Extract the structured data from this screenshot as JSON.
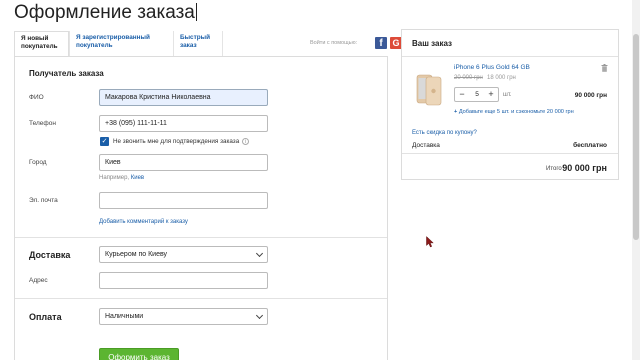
{
  "page": {
    "title": "Оформление заказа"
  },
  "tabs": [
    {
      "label_line1": "Я новый",
      "label_line2": "покупатель",
      "active": true
    },
    {
      "label_line1": "Я зарегистрированный",
      "label_line2": "покупатель",
      "active": false
    },
    {
      "label_line1": "Быстрый",
      "label_line2": "заказ",
      "active": false
    }
  ],
  "social": {
    "label": "Войти с помощью:",
    "facebook_glyph": "f",
    "google_glyph": "G"
  },
  "recipient": {
    "title": "Получатель заказа",
    "name_label": "ФИО",
    "name_value": "Макарова Кристина Николаевна",
    "phone_label": "Телефон",
    "phone_value": "+38 (095) 111-11-11",
    "no_call_label": "Не звонить мне для подтверждения заказа",
    "city_label": "Город",
    "city_value": "Киев",
    "city_hint_prefix": "Например,",
    "city_hint_link": "Киев",
    "email_label": "Эл. почта",
    "email_value": "",
    "add_comment_link": "Добавить комментарий к заказу"
  },
  "delivery": {
    "title": "Доставка",
    "method_value": "Курьером по Киеву",
    "address_label": "Адрес",
    "address_value": ""
  },
  "payment": {
    "title": "Оплата",
    "method_value": "Наличными"
  },
  "submit": {
    "label": "Оформить заказ"
  },
  "order": {
    "title": "Ваш заказ",
    "product_name": "iPhone 6 Plus Gold 64 GB",
    "old_price": "20 000 грн",
    "unit_price": "18 000 грн",
    "quantity": "5",
    "quantity_unit": "шт.",
    "line_total": "90 000 грн",
    "upsell": "Добавьте еще 5 шт. и сэкономьте 20 000 грн",
    "coupon_link": "Есть скидка по купону?",
    "delivery_label": "Доставка",
    "delivery_value": "бесплатно",
    "total_label": "Итого",
    "total_value": "90 000 грн"
  },
  "colors": {
    "accent": "#1a5ea8",
    "button": "#5cb531",
    "facebook": "#3b5998",
    "google": "#dd4b39"
  }
}
